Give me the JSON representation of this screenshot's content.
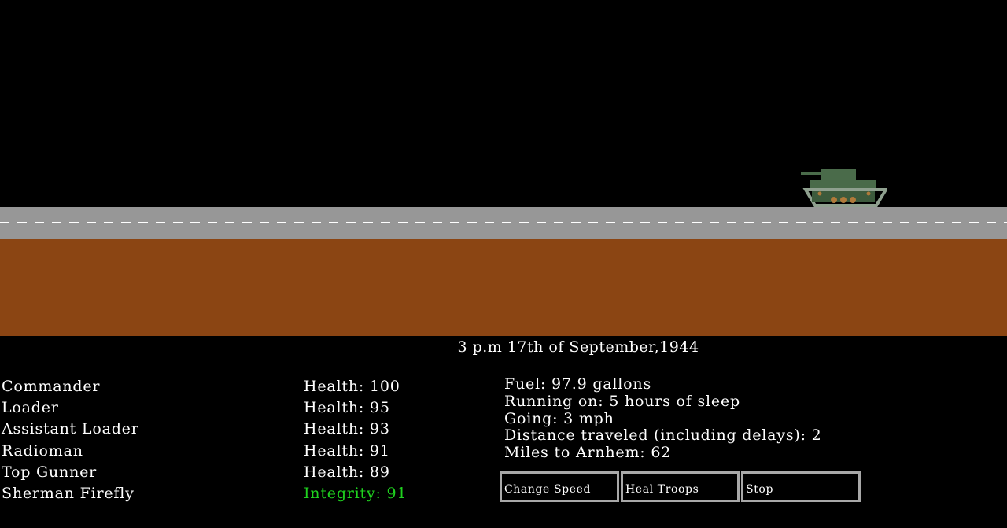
{
  "scene": {
    "colors": {
      "sky": "#000000",
      "road": "#979797",
      "road_line": "#ffffff",
      "dirt": "#8b4513",
      "tank_body": "#4a6b4a",
      "tank_track": "#8fa08f"
    }
  },
  "date": "3 p.m 17th of September,1944",
  "crew": [
    {
      "role": "Commander",
      "status": "Health: 100"
    },
    {
      "role": "Loader",
      "status": "Health: 95"
    },
    {
      "role": "Assistant Loader",
      "status": "Health: 93"
    },
    {
      "role": "Radioman",
      "status": "Health: 91"
    },
    {
      "role": "Top Gunner",
      "status": "Health: 89"
    },
    {
      "role": "Sherman Firefly",
      "status": "Integrity: 91"
    }
  ],
  "stats": {
    "fuel": "Fuel: 97.9 gallons",
    "sleep": "Running on: 5 hours of sleep",
    "speed": "Going: 3 mph",
    "distance": "Distance traveled (including delays): 2",
    "miles_left": "Miles to Arnhem: 62"
  },
  "buttons": {
    "change_speed": "Change Speed",
    "heal_troops": "Heal Troops",
    "stop": "Stop"
  },
  "colors": {
    "integrity": "#1fd21f",
    "button_border": "#a8a8a8"
  }
}
